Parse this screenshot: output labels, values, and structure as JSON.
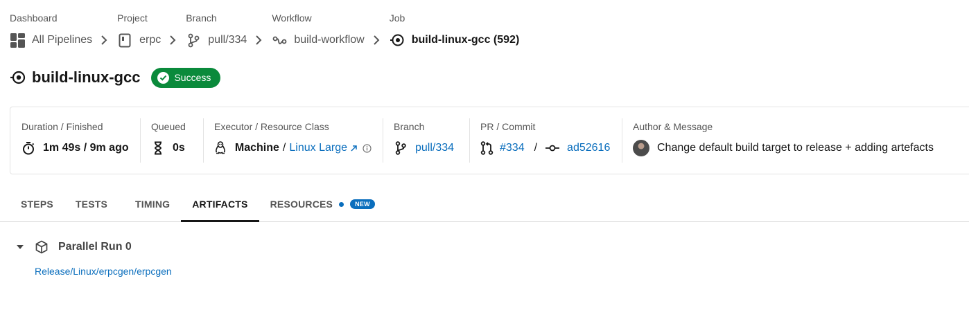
{
  "breadcrumb": {
    "items": [
      {
        "label": "Dashboard",
        "text": "All Pipelines"
      },
      {
        "label": "Project",
        "text": "erpc"
      },
      {
        "label": "Branch",
        "text": "pull/334"
      },
      {
        "label": "Workflow",
        "text": "build-workflow"
      },
      {
        "label": "Job",
        "text": "build-linux-gcc (592)"
      }
    ]
  },
  "job": {
    "title": "build-linux-gcc",
    "status": "Success",
    "status_color": "#0a8a3b"
  },
  "info": {
    "duration": {
      "label": "Duration / Finished",
      "value": "1m 49s / 9m ago"
    },
    "queued": {
      "label": "Queued",
      "value": "0s"
    },
    "executor": {
      "label": "Executor / Resource Class",
      "type": "Machine",
      "divider": "/",
      "resource_class": "Linux Large"
    },
    "branch": {
      "label": "Branch",
      "value": "pull/334"
    },
    "pr_commit": {
      "label": "PR / Commit",
      "pr": "#334",
      "divider": "/",
      "commit": "ad52616"
    },
    "author": {
      "label": "Author & Message",
      "message": "Change default build target to release + adding artefacts"
    }
  },
  "tabs": [
    {
      "label": "STEPS"
    },
    {
      "label": "TESTS"
    },
    {
      "label": "TIMING"
    },
    {
      "label": "ARTIFACTS",
      "active": true
    },
    {
      "label": "RESOURCES",
      "badge": "NEW"
    }
  ],
  "artifacts": {
    "run_title": "Parallel Run 0",
    "files": [
      "Release/Linux/erpcgen/erpcgen"
    ]
  },
  "colors": {
    "link": "#0a6ebd",
    "accent_new": "#0a6ebd"
  }
}
